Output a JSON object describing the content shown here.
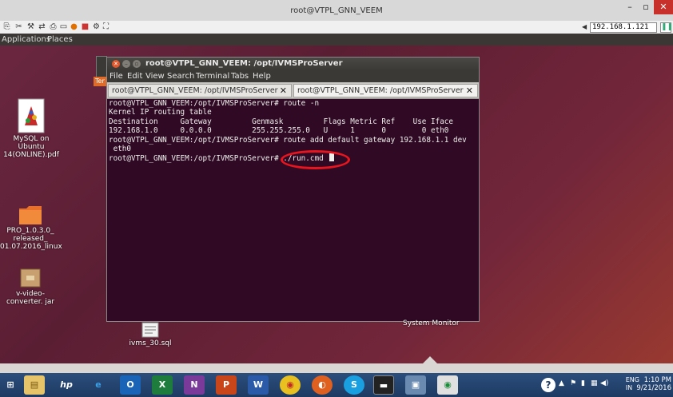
{
  "viewer": {
    "title": "root@VTPL_GNN_VEEM",
    "ip_address": "192.168.1.121",
    "controls": {
      "minimize": "–",
      "restore": "▫",
      "close": "✕"
    }
  },
  "top_panel": {
    "applications": "Applications",
    "places": "Places"
  },
  "desktop_icons": [
    {
      "label": "MySQL on Ubuntu 14(ONLINE).pdf"
    },
    {
      "label": "PRO_1.0.3.0_ released_ 01.07.2016_linux"
    },
    {
      "label": "v-video-converter. jar"
    },
    {
      "label": "ivms_30.sql"
    }
  ],
  "side_tab_label": "Ter",
  "terminal": {
    "title": "root@VTPL_GNN_VEEM: /opt/IVMSProServer",
    "menu": [
      "File",
      "Edit",
      "View",
      "Search",
      "Terminal",
      "Tabs",
      "Help"
    ],
    "tabs": [
      {
        "label": "root@VTPL_GNN_VEEM: /opt/IVMSProServer"
      },
      {
        "label": "root@VTPL_GNN_VEEM: /opt/IVMSProServer"
      }
    ],
    "lines": [
      "root@VTPL_GNN_VEEM:/opt/IVMSProServer# route -n",
      "Kernel IP routing table",
      "Destination     Gateway         Genmask         Flags Metric Ref    Use Iface",
      "192.168.1.0     0.0.0.0         255.255.255.0   U     1      0        0 eth0",
      "root@VTPL_GNN_VEEM:/opt/IVMSProServer# route add default gateway 192.168.1.1 dev",
      " eth0",
      "root@VTPL_GNN_VEEM:/opt/IVMSProServer# ./run.cmd "
    ]
  },
  "system_monitor_label": "System Monitor",
  "tray": {
    "lang_top": "ENG",
    "lang_bottom": "IN",
    "time": "1:10 PM",
    "date": "9/21/2016"
  },
  "colors": {
    "terminal_bg": "#300a24",
    "highlight": "#e8141e"
  }
}
